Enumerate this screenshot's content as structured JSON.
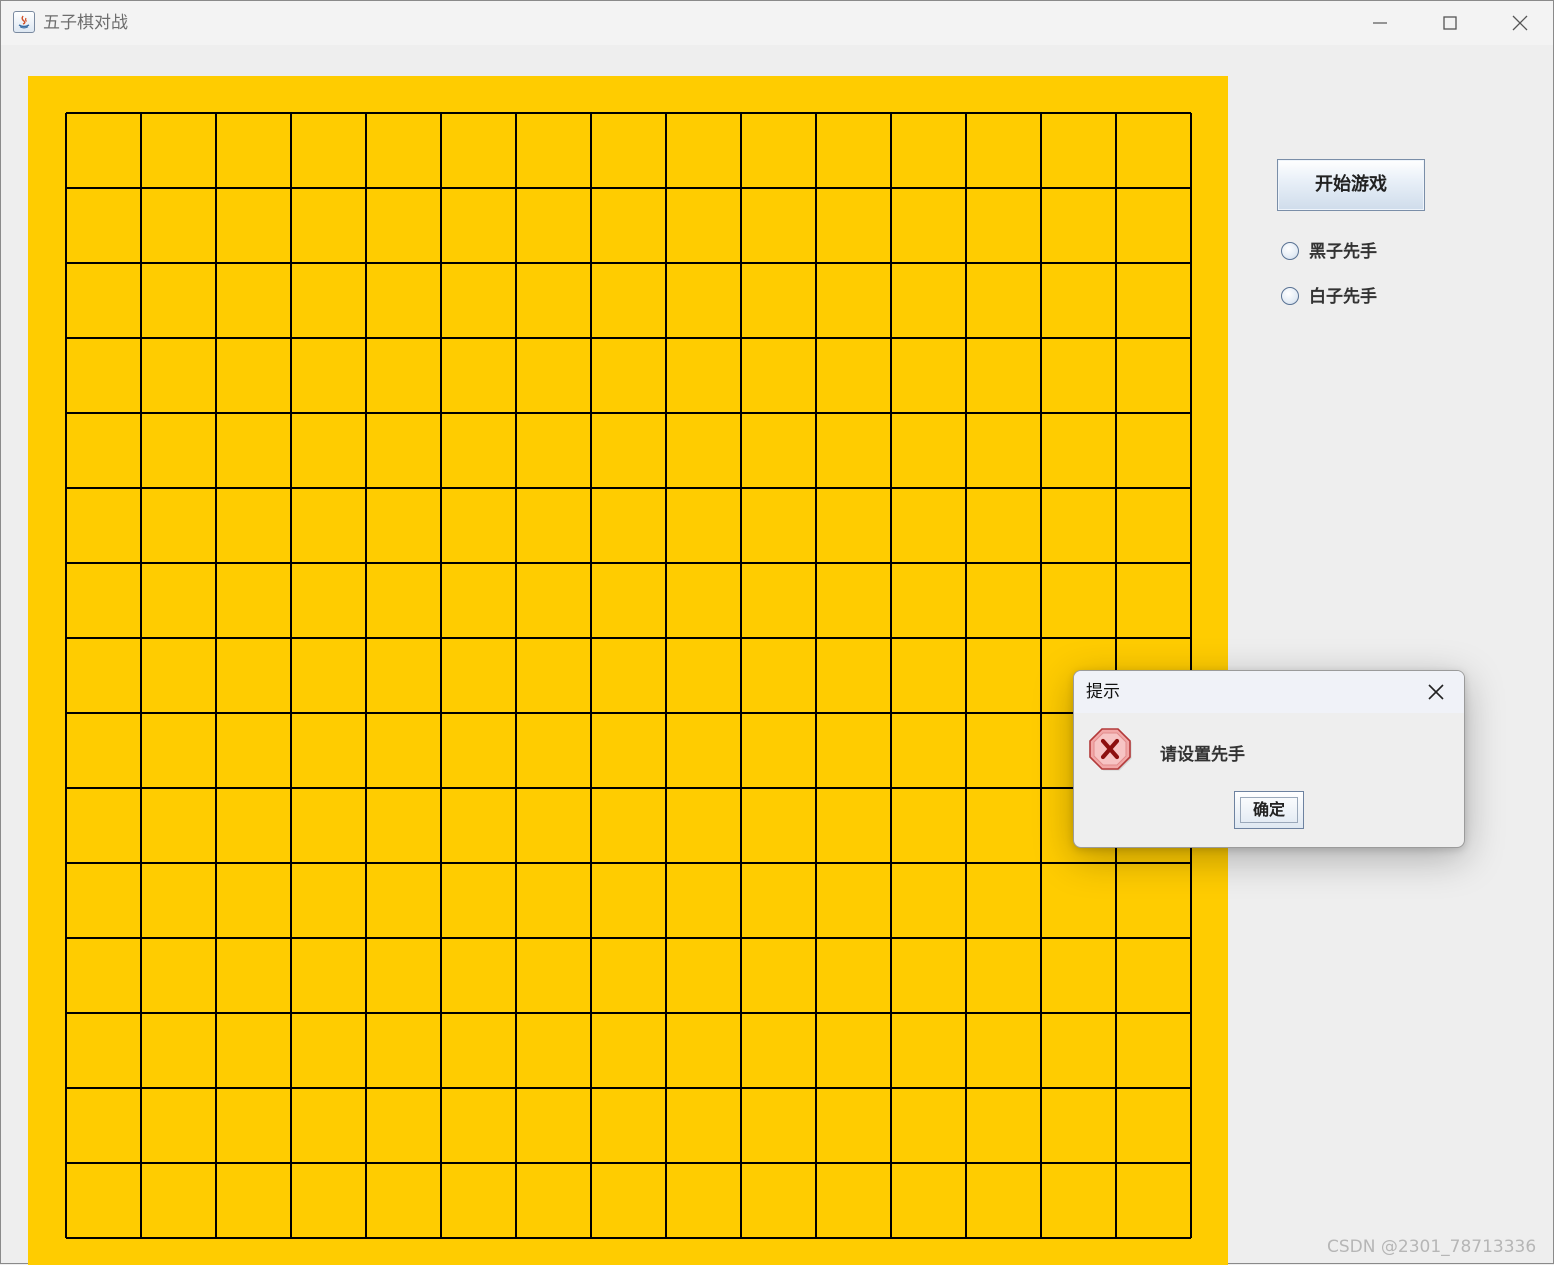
{
  "window": {
    "title": "五子棋对战"
  },
  "board": {
    "color": "#ffcc00",
    "line_color": "#000000",
    "cells": 15
  },
  "controls": {
    "start_button_label": "开始游戏",
    "radio_black_first": "黑子先手",
    "radio_white_first": "白子先手"
  },
  "dialog": {
    "title": "提示",
    "message": "请设置先手",
    "ok_label": "确定",
    "icon": "error-icon"
  },
  "watermark": "CSDN @2301_78713336"
}
